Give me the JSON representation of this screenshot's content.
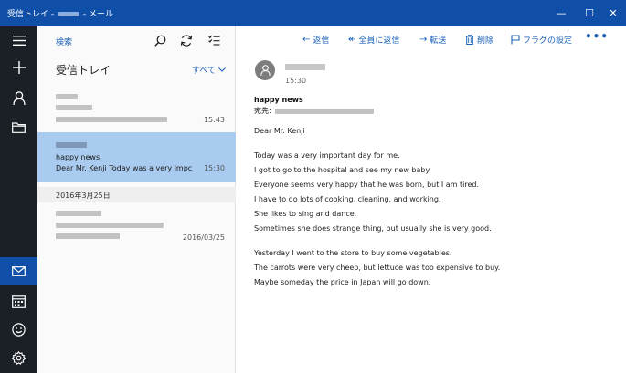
{
  "window": {
    "title_prefix": "受信トレイ - ",
    "title_suffix": " - メール",
    "controls": {
      "minimize": "—",
      "maximize": "☐",
      "close": "✕"
    }
  },
  "rail": {
    "items": [
      {
        "id": "menu",
        "icon": "hamburger-icon"
      },
      {
        "id": "new",
        "icon": "plus-icon"
      },
      {
        "id": "accounts",
        "icon": "person-icon"
      },
      {
        "id": "folders",
        "icon": "folder-icon"
      },
      {
        "id": "mail",
        "icon": "mail-icon",
        "active": true
      },
      {
        "id": "calendar",
        "icon": "calendar-icon"
      },
      {
        "id": "feedback",
        "icon": "smiley-icon"
      },
      {
        "id": "settings",
        "icon": "gear-icon"
      }
    ]
  },
  "list": {
    "search_label": "検索",
    "folder_title": "受信トレイ",
    "filter_label": "すべて",
    "tools": [
      "search-icon",
      "sync-icon",
      "select-mode-icon"
    ],
    "messages": [
      {
        "time": "15:43",
        "selected": false
      },
      {
        "subject": "happy news",
        "preview": "Dear Mr. Kenji Today was a very impc",
        "time": "15:30",
        "selected": true
      },
      {
        "time": "2016/03/25",
        "selected": false
      }
    ],
    "section_header": "2016年3月25日"
  },
  "reader": {
    "toolbar": {
      "reply": "返信",
      "reply_all": "全員に返信",
      "forward": "転送",
      "delete": "削除",
      "flag": "フラグの設定",
      "more": "•••"
    },
    "sent_time": "15:30",
    "subject": "happy news",
    "to_label": "宛先:",
    "greeting": "Dear Mr. Kenji",
    "paragraph1": [
      "Today was a very important day for me.",
      "I got to go to the hospital and see my new baby.",
      "Everyone seems very happy that he was born, but I am tired.",
      "I have to do lots of cooking, cleaning, and working.",
      "She likes to sing and dance.",
      "Sometimes she does strange thing, but usually she is very good."
    ],
    "paragraph2": [
      "Yesterday I went to the store to buy some vegetables.",
      "The carrots were very cheep, but lettuce was too expensive to buy.",
      "Maybe someday the price in Japan will go down."
    ]
  },
  "colors": {
    "accent": "#0f4fa8",
    "link": "#1c62b9",
    "rail": "#1b2027",
    "selected": "#a9cbef"
  }
}
